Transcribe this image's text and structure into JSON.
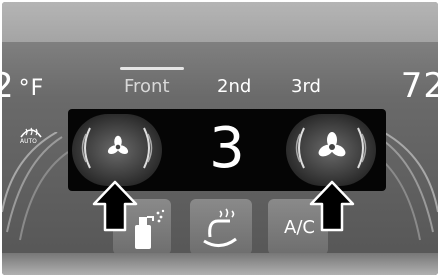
{
  "climate": {
    "left_temp": "2",
    "left_unit": "°F",
    "right_temp": "72",
    "tabs": [
      "Front",
      "2nd",
      "3rd"
    ],
    "active_tab": "Front",
    "fan_speed": "3",
    "defrost_label": "AUTO",
    "ac_label": "A/C"
  },
  "icons": {
    "defrost": "rear-defrost-icon",
    "fan_decrease": "fan-small-icon",
    "fan_increase": "fan-large-icon",
    "arrows": "callout-arrow-icon",
    "spray": "spray-bottle-icon",
    "seat": "heated-seat-icon"
  },
  "colors": {
    "panel": "#050505",
    "text": "#ffffff",
    "arrow": "#000000"
  }
}
